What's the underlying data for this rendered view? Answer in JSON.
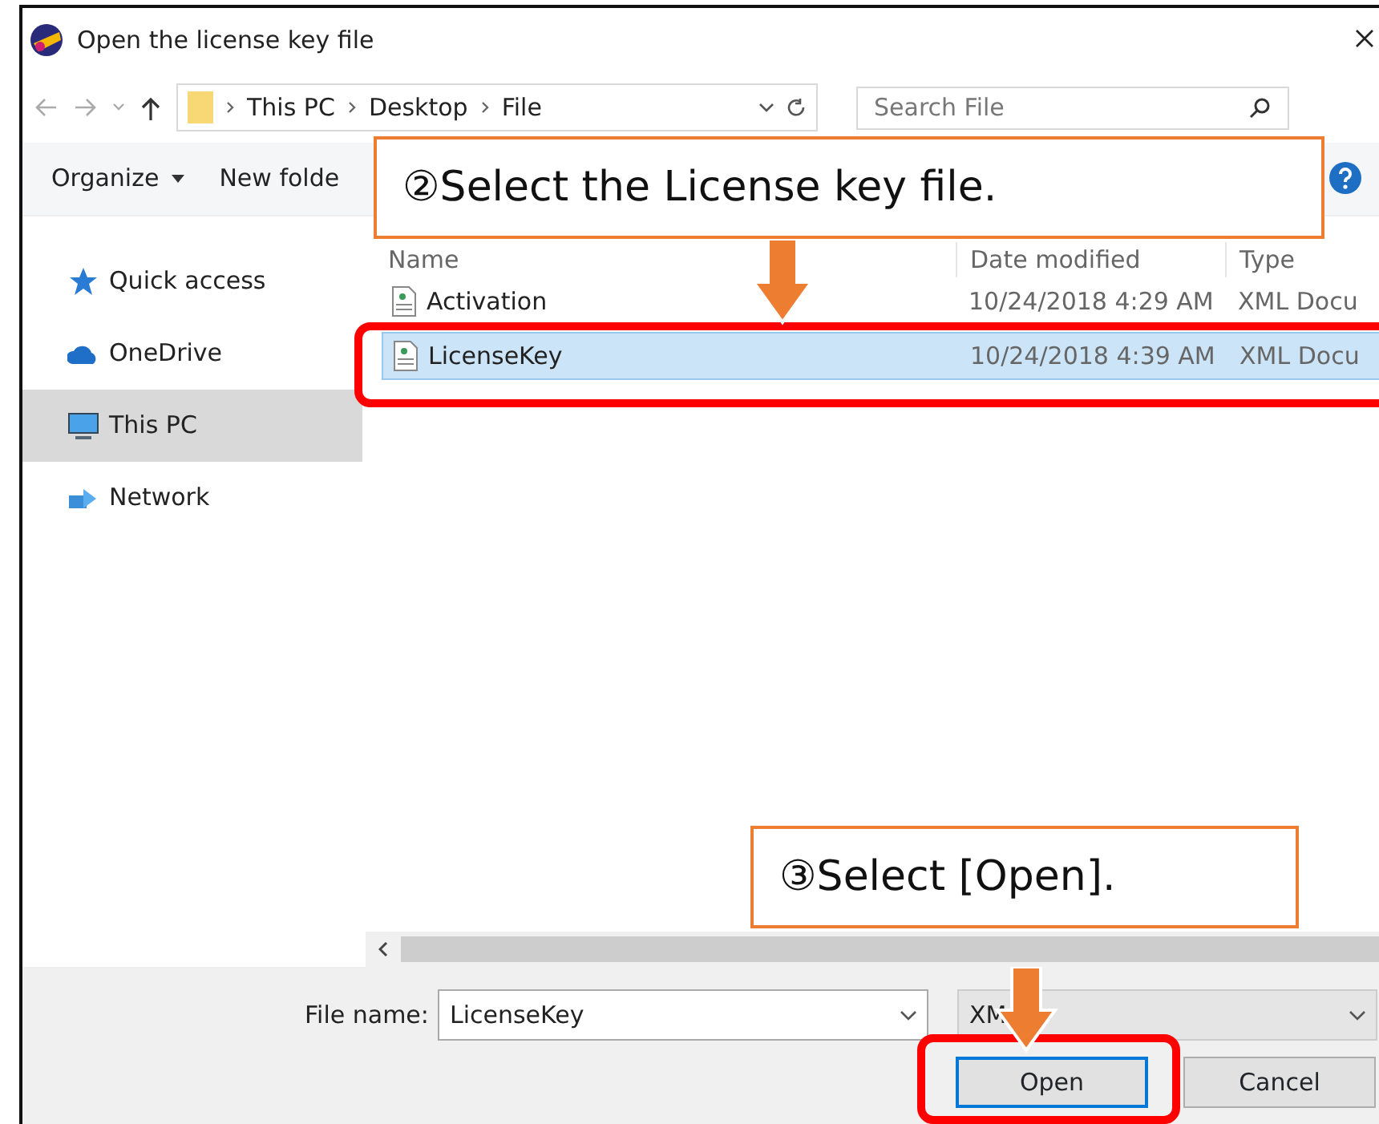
{
  "window": {
    "title": "Open the license key file"
  },
  "address_bar": {
    "path": [
      "This PC",
      "Desktop",
      "File"
    ]
  },
  "search": {
    "placeholder": "Search File"
  },
  "toolbar": [
    {
      "label": "Organize",
      "dropdown": true
    },
    {
      "label": "New folde",
      "dropdown": false
    }
  ],
  "sidebar": {
    "items": [
      {
        "label": "Quick access",
        "kind": "star",
        "selected": false
      },
      {
        "label": "OneDrive",
        "kind": "cloud",
        "selected": false
      },
      {
        "label": "This PC",
        "kind": "monitor",
        "selected": true
      },
      {
        "label": "Network",
        "kind": "network",
        "selected": false
      }
    ]
  },
  "table": {
    "columns": [
      "Name",
      "Date modified",
      "Type"
    ],
    "rows": [
      {
        "name": "Activation",
        "date": "10/24/2018 4:29 AM",
        "type": "XML Docu",
        "selected": false
      },
      {
        "name": "LicenseKey",
        "date": "10/24/2018 4:39 AM",
        "type": "XML Docu",
        "selected": true
      }
    ]
  },
  "file_name": {
    "label": "File name:",
    "value": "LicenseKey"
  },
  "file_type": {
    "value": "XM"
  },
  "buttons": [
    {
      "label": "Open",
      "default": true
    },
    {
      "label": "Cancel",
      "default": false
    }
  ],
  "callouts": [
    {
      "text": "②Select the License key file."
    },
    {
      "text": "③Select [Open]."
    }
  ]
}
